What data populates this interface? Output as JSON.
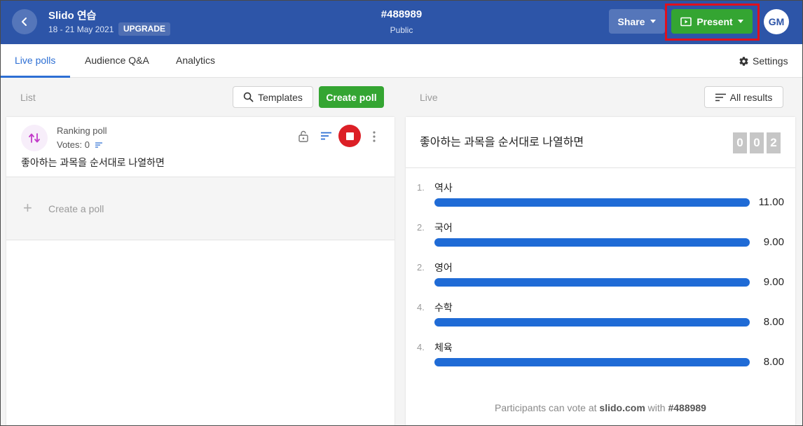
{
  "header": {
    "event_title": "Slido 연습",
    "event_dates": "18 - 21 May 2021",
    "upgrade_label": "UPGRADE",
    "event_code": "#488989",
    "event_privacy": "Public",
    "share_label": "Share",
    "present_label": "Present",
    "avatar_initials": "GM",
    "highlight_color": "#e0101d"
  },
  "tabs": [
    {
      "label": "Live polls",
      "active": true
    },
    {
      "label": "Audience Q&A",
      "active": false
    },
    {
      "label": "Analytics",
      "active": false
    }
  ],
  "settings_label": "Settings",
  "left": {
    "column_label": "List",
    "templates_label": "Templates",
    "create_poll_label": "Create poll",
    "poll": {
      "type_label": "Ranking poll",
      "votes_text": "Votes: 0",
      "question": "좋아하는 과목을 순서대로 나열하면"
    },
    "create_row_label": "Create a poll"
  },
  "right": {
    "column_label": "Live",
    "all_results_label": "All results",
    "poll_title": "좋아하는 과목을 순서대로 나열하면",
    "counter_digits": [
      "0",
      "0",
      "2"
    ],
    "results": [
      {
        "rank": "1.",
        "label": "역사",
        "value": "11.00",
        "fill": 1.0
      },
      {
        "rank": "2.",
        "label": "국어",
        "value": "9.00",
        "fill": 1.0
      },
      {
        "rank": "2.",
        "label": "영어",
        "value": "9.00",
        "fill": 1.0
      },
      {
        "rank": "4.",
        "label": "수학",
        "value": "8.00",
        "fill": 1.0
      },
      {
        "rank": "4.",
        "label": "체육",
        "value": "8.00",
        "fill": 1.0
      }
    ],
    "footer": {
      "prefix": "Participants can vote at ",
      "site": "slido.com",
      "middle": " with ",
      "code": "#488989"
    }
  },
  "colors": {
    "header_bg": "#2d55a8",
    "present_green": "#34a532",
    "accent_blue": "#2d6fd4",
    "bar_blue": "#1f6bd6",
    "stop_red": "#dc1f26"
  }
}
